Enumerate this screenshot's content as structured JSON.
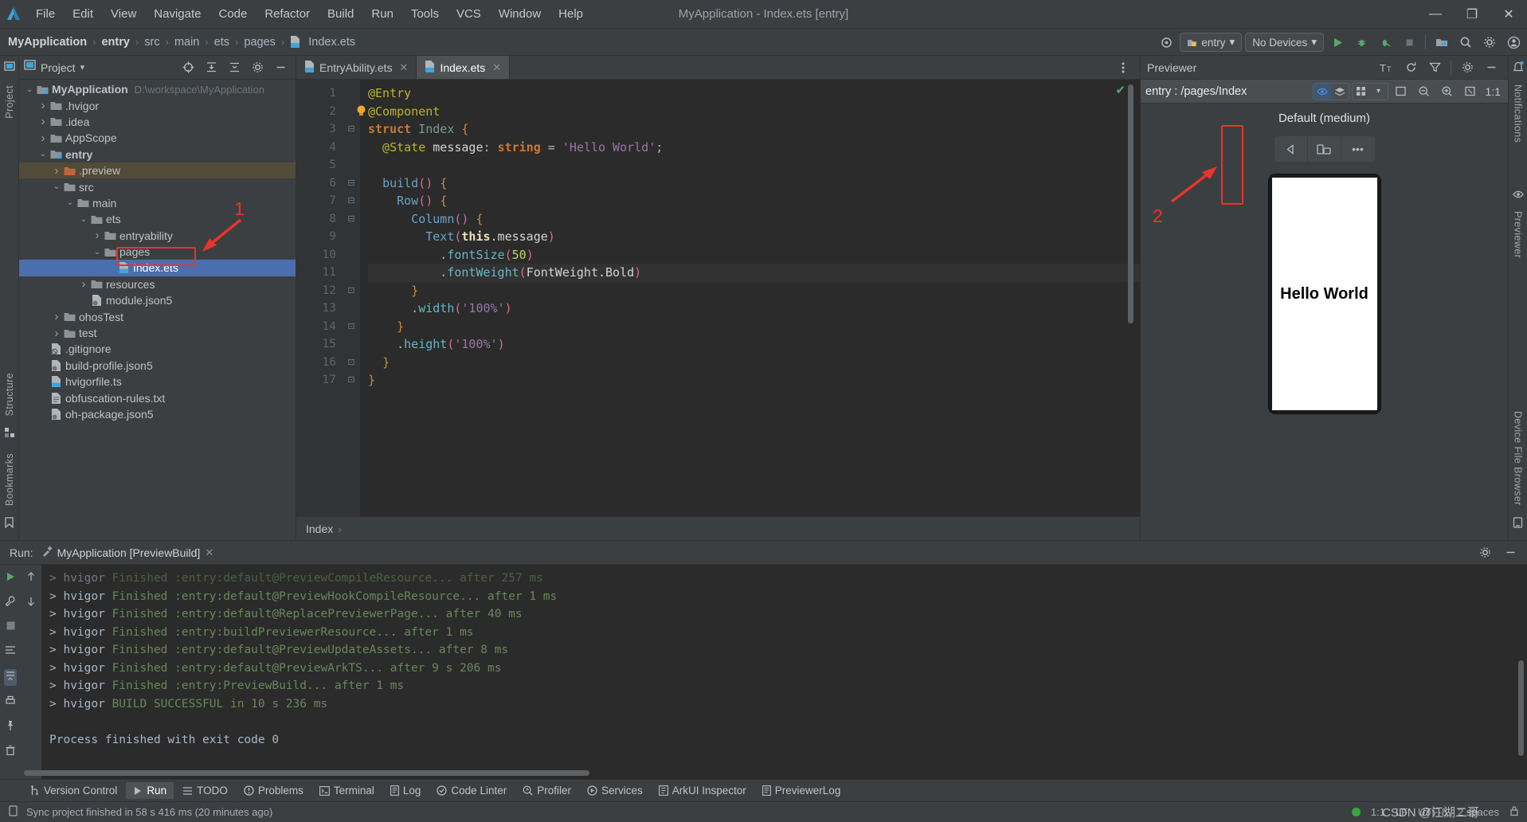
{
  "window": {
    "title": "MyApplication - Index.ets [entry]",
    "minimize": "—",
    "maximize": "❐",
    "close": "✕"
  },
  "menubar": {
    "items": [
      "File",
      "Edit",
      "View",
      "Navigate",
      "Code",
      "Refactor",
      "Build",
      "Run",
      "Tools",
      "VCS",
      "Window",
      "Help"
    ]
  },
  "breadcrumb": {
    "items": [
      "MyApplication",
      "entry",
      "src",
      "main",
      "ets",
      "pages",
      "Index.ets"
    ],
    "separator": "›"
  },
  "navbar_right": {
    "run_config": "entry",
    "device": "No Devices",
    "chevron": "▾"
  },
  "project_panel": {
    "title": "Project",
    "chevron": "▾",
    "tree": [
      {
        "label": "MyApplication",
        "path": "D:\\workspace\\MyApplication",
        "depth": 0,
        "arrow": "v",
        "icon": "module-folder",
        "bold": true
      },
      {
        "label": ".hvigor",
        "depth": 1,
        "arrow": ">",
        "icon": "folder"
      },
      {
        "label": ".idea",
        "depth": 1,
        "arrow": ">",
        "icon": "folder"
      },
      {
        "label": "AppScope",
        "depth": 1,
        "arrow": ">",
        "icon": "folder"
      },
      {
        "label": "entry",
        "depth": 1,
        "arrow": "v",
        "icon": "module-folder",
        "bold": true
      },
      {
        "label": ".preview",
        "depth": 2,
        "arrow": ">",
        "icon": "folder-orange",
        "highlight": true
      },
      {
        "label": "src",
        "depth": 2,
        "arrow": "v",
        "icon": "folder"
      },
      {
        "label": "main",
        "depth": 3,
        "arrow": "v",
        "icon": "folder"
      },
      {
        "label": "ets",
        "depth": 4,
        "arrow": "v",
        "icon": "folder"
      },
      {
        "label": "entryability",
        "depth": 5,
        "arrow": ">",
        "icon": "folder"
      },
      {
        "label": "pages",
        "depth": 5,
        "arrow": "v",
        "icon": "folder"
      },
      {
        "label": "Index.ets",
        "depth": 6,
        "arrow": "",
        "icon": "ets-file",
        "selected": true
      },
      {
        "label": "resources",
        "depth": 4,
        "arrow": ">",
        "icon": "folder"
      },
      {
        "label": "module.json5",
        "depth": 4,
        "arrow": "",
        "icon": "json-file"
      },
      {
        "label": "ohosTest",
        "depth": 2,
        "arrow": ">",
        "icon": "folder"
      },
      {
        "label": "test",
        "depth": 2,
        "arrow": ">",
        "icon": "folder"
      },
      {
        "label": ".gitignore",
        "depth": 1,
        "arrow": "",
        "icon": "gitignore-file"
      },
      {
        "label": "build-profile.json5",
        "depth": 1,
        "arrow": "",
        "icon": "json-file"
      },
      {
        "label": "hvigorfile.ts",
        "depth": 1,
        "arrow": "",
        "icon": "ts-file"
      },
      {
        "label": "obfuscation-rules.txt",
        "depth": 1,
        "arrow": "",
        "icon": "txt-file"
      },
      {
        "label": "oh-package.json5",
        "depth": 1,
        "arrow": "",
        "icon": "json-file"
      }
    ]
  },
  "editor": {
    "tabs": [
      {
        "label": "EntryAbility.ets",
        "active": false,
        "close": "✕"
      },
      {
        "label": "Index.ets",
        "active": true,
        "close": "✕"
      }
    ],
    "breadcrumb": "Index",
    "breadcrumb_sep": "›",
    "inspection_status": "✔",
    "lines": [
      {
        "n": "1",
        "fold": "",
        "tokens": [
          {
            "t": "@Entry",
            "c": "k-ann"
          }
        ]
      },
      {
        "n": "2",
        "fold": "",
        "tokens": [
          {
            "t": "@Component",
            "c": "k-ann"
          }
        ]
      },
      {
        "n": "3",
        "fold": "⊟",
        "tokens": [
          {
            "t": "struct ",
            "c": "k-kw"
          },
          {
            "t": "Index ",
            "c": "k-cls"
          },
          {
            "t": "{",
            "c": "k-brace"
          }
        ]
      },
      {
        "n": "4",
        "fold": "",
        "tokens": [
          {
            "t": "  @State ",
            "c": "k-ann"
          },
          {
            "t": "message",
            "c": "k-plain"
          },
          {
            "t": ": ",
            "c": "k-punct"
          },
          {
            "t": "string ",
            "c": "k-kw"
          },
          {
            "t": "= ",
            "c": "k-punct"
          },
          {
            "t": "'Hello World'",
            "c": "k-str"
          },
          {
            "t": ";",
            "c": "k-punct"
          }
        ]
      },
      {
        "n": "5",
        "fold": "",
        "tokens": []
      },
      {
        "n": "6",
        "fold": "⊟",
        "tokens": [
          {
            "t": "  ",
            "c": "k-punct"
          },
          {
            "t": "build",
            "c": "k-fn"
          },
          {
            "t": "()",
            "c": "k-paren"
          },
          {
            "t": " ",
            "c": "k-punct"
          },
          {
            "t": "{",
            "c": "k-brace"
          }
        ]
      },
      {
        "n": "7",
        "fold": "⊟",
        "tokens": [
          {
            "t": "    ",
            "c": "k-punct"
          },
          {
            "t": "Row",
            "c": "k-fn"
          },
          {
            "t": "()",
            "c": "k-paren"
          },
          {
            "t": " ",
            "c": "k-punct"
          },
          {
            "t": "{",
            "c": "k-brace"
          }
        ]
      },
      {
        "n": "8",
        "fold": "⊟",
        "tokens": [
          {
            "t": "      ",
            "c": "k-punct"
          },
          {
            "t": "Column",
            "c": "k-fn"
          },
          {
            "t": "()",
            "c": "k-paren"
          },
          {
            "t": " ",
            "c": "k-punct"
          },
          {
            "t": "{",
            "c": "k-brace"
          }
        ]
      },
      {
        "n": "9",
        "fold": "",
        "tokens": [
          {
            "t": "        ",
            "c": "k-punct"
          },
          {
            "t": "Text",
            "c": "k-fn"
          },
          {
            "t": "(",
            "c": "k-paren"
          },
          {
            "t": "this",
            "c": "k-this"
          },
          {
            "t": ".message",
            "c": "k-plain"
          },
          {
            "t": ")",
            "c": "k-paren"
          }
        ]
      },
      {
        "n": "10",
        "fold": "",
        "tokens": [
          {
            "t": "          .",
            "c": "k-punct"
          },
          {
            "t": "fontSize",
            "c": "k-prop"
          },
          {
            "t": "(",
            "c": "k-paren"
          },
          {
            "t": "50",
            "c": "k-num"
          },
          {
            "t": ")",
            "c": "k-paren"
          }
        ]
      },
      {
        "n": "11",
        "fold": "",
        "tokens": [
          {
            "t": "          .",
            "c": "k-punct"
          },
          {
            "t": "fontWeight",
            "c": "k-prop"
          },
          {
            "t": "(",
            "c": "k-paren"
          },
          {
            "t": "FontWeight.Bold",
            "c": "k-plain"
          },
          {
            "t": ")",
            "c": "k-paren"
          }
        ],
        "current": true
      },
      {
        "n": "12",
        "fold": "⊡",
        "tokens": [
          {
            "t": "      ",
            "c": "k-punct"
          },
          {
            "t": "}",
            "c": "k-brace"
          }
        ]
      },
      {
        "n": "13",
        "fold": "",
        "tokens": [
          {
            "t": "      .",
            "c": "k-punct"
          },
          {
            "t": "width",
            "c": "k-prop"
          },
          {
            "t": "(",
            "c": "k-paren"
          },
          {
            "t": "'100%'",
            "c": "k-str"
          },
          {
            "t": ")",
            "c": "k-paren"
          }
        ]
      },
      {
        "n": "14",
        "fold": "⊡",
        "tokens": [
          {
            "t": "    ",
            "c": "k-punct"
          },
          {
            "t": "}",
            "c": "k-brace"
          }
        ]
      },
      {
        "n": "15",
        "fold": "",
        "tokens": [
          {
            "t": "    .",
            "c": "k-punct"
          },
          {
            "t": "height",
            "c": "k-prop"
          },
          {
            "t": "(",
            "c": "k-paren"
          },
          {
            "t": "'100%'",
            "c": "k-str"
          },
          {
            "t": ")",
            "c": "k-paren"
          }
        ]
      },
      {
        "n": "16",
        "fold": "⊡",
        "tokens": [
          {
            "t": "  ",
            "c": "k-punct"
          },
          {
            "t": "}",
            "c": "k-brace"
          }
        ]
      },
      {
        "n": "17",
        "fold": "⊡",
        "tokens": [
          {
            "t": "}",
            "c": "k-brace"
          }
        ]
      }
    ]
  },
  "previewer": {
    "title": "Previewer",
    "path": "entry : /pages/Index",
    "device_label": "Default (medium)",
    "zoom_ratio": "1:1",
    "phone_text": "Hello World",
    "ctrl_back": "◁",
    "ctrl_rotate": "rotate",
    "ctrl_more": "•••"
  },
  "run_panel": {
    "label": "Run:",
    "tab": "MyApplication [PreviewBuild]",
    "tab_close": "✕",
    "lines": [
      {
        "prefix": "> hvigor ",
        "status": "Finished ",
        "text": ":entry:default@PreviewCompileResource... after 257 ms",
        "faded": true
      },
      {
        "prefix": "> hvigor ",
        "status": "Finished ",
        "text": ":entry:default@PreviewHookCompileResource... after 1 ms"
      },
      {
        "prefix": "> hvigor ",
        "status": "Finished ",
        "text": ":entry:default@ReplacePreviewerPage... after 40 ms"
      },
      {
        "prefix": "> hvigor ",
        "status": "Finished ",
        "text": ":entry:buildPreviewerResource... after 1 ms"
      },
      {
        "prefix": "> hvigor ",
        "status": "Finished ",
        "text": ":entry:default@PreviewUpdateAssets... after 8 ms"
      },
      {
        "prefix": "> hvigor ",
        "status": "Finished ",
        "text": ":entry:default@PreviewArkTS... after 9 s 206 ms"
      },
      {
        "prefix": "> hvigor ",
        "status": "Finished ",
        "text": ":entry:PreviewBuild... after 1 ms"
      },
      {
        "prefix": "> hvigor ",
        "status": "BUILD SUCCESSFUL ",
        "text": "in 10 s 236 ms"
      },
      {
        "prefix": "",
        "status": "",
        "text": ""
      },
      {
        "prefix": "",
        "status": "",
        "text": "Process finished with exit code 0",
        "plain": true
      }
    ]
  },
  "tool_windows": [
    {
      "label": "Version Control",
      "icon": "branch-icon",
      "active": false
    },
    {
      "label": "Run",
      "icon": "play-icon",
      "active": true
    },
    {
      "label": "TODO",
      "icon": "list-icon",
      "active": false
    },
    {
      "label": "Problems",
      "icon": "warning-icon",
      "active": false
    },
    {
      "label": "Terminal",
      "icon": "terminal-icon",
      "active": false
    },
    {
      "label": "Log",
      "icon": "log-icon",
      "active": false
    },
    {
      "label": "Code Linter",
      "icon": "linter-icon",
      "active": false
    },
    {
      "label": "Profiler",
      "icon": "profiler-icon",
      "active": false
    },
    {
      "label": "Services",
      "icon": "services-icon",
      "active": false
    },
    {
      "label": "ArkUI Inspector",
      "icon": "inspector-icon",
      "active": false
    },
    {
      "label": "PreviewerLog",
      "icon": "previewerlog-icon",
      "active": false
    }
  ],
  "statusbar": {
    "message": "Sync project finished in 58 s 416 ms (20 minutes ago)",
    "caret": "1:1",
    "line_sep": "LF",
    "encoding": "UTF-8",
    "indent": "2 spaces",
    "watermark": "CSDN @江湖二哥"
  },
  "side_strips": {
    "left_top": "Project",
    "left_mid": "Structure",
    "left_bottom": "Bookmarks",
    "right_top": "Notifications",
    "right_mid": "Previewer",
    "right_bottom": "Device File Browser"
  },
  "annotations": [
    {
      "id": "1",
      "label": "1"
    },
    {
      "id": "2",
      "label": "2"
    }
  ],
  "colors": {
    "accent_blue": "#4b6eaf",
    "annotation_red": "#e8342a",
    "console_green": "#6a8759",
    "panel_bg": "#3c3f41",
    "editor_bg": "#2b2b2b"
  }
}
